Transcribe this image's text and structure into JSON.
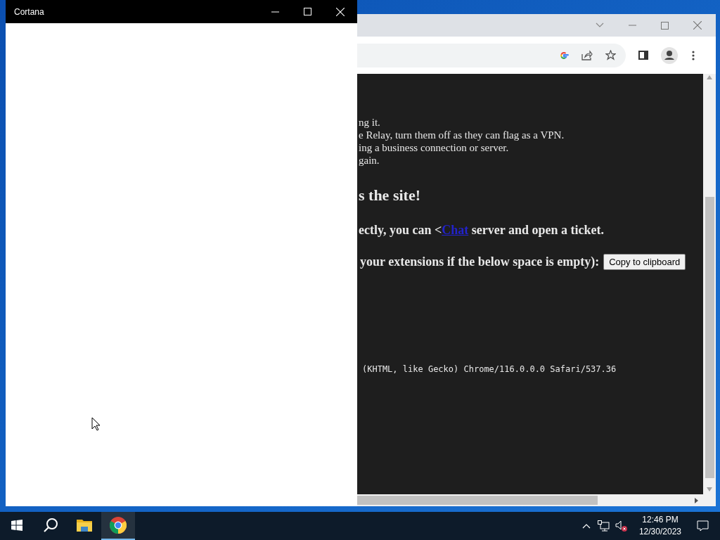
{
  "cortana_window": {
    "title": "Cortana"
  },
  "browser": {
    "lines": [
      "ng it.",
      "e Relay, turn them off as they can flag as a VPN.",
      "ing a business connection or server.",
      "gain."
    ],
    "heading": "s the site!",
    "ticket_line": {
      "before": "ectly, you can <",
      "link": "Chat",
      "after": " server and open a ticket."
    },
    "extensions_line": {
      "label": "your extensions if the below space is empty):",
      "button": "Copy to clipboard"
    },
    "user_agent": "(KHTML, like Gecko) Chrome/116.0.0.0 Safari/537.36"
  },
  "taskbar": {
    "apps": [
      {
        "kind": "start",
        "active": false
      },
      {
        "kind": "search",
        "active": false
      },
      {
        "kind": "files",
        "active": false
      },
      {
        "kind": "chrome",
        "active": true
      }
    ],
    "volume_muted": true,
    "time": "12:46 PM",
    "date": "12/30/2023"
  }
}
